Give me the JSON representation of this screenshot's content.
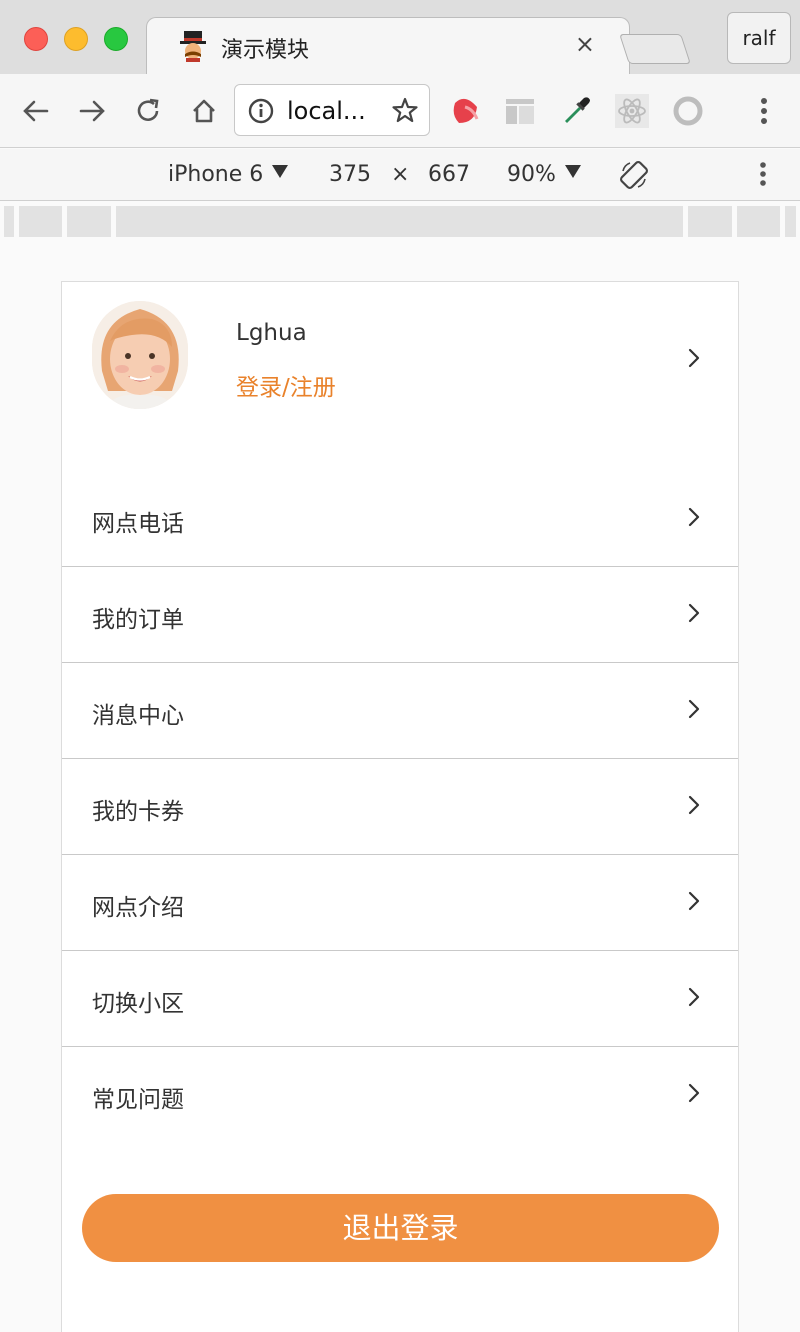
{
  "browser": {
    "tab_title": "演示模块",
    "tab_close": "×",
    "profile_label": "ralf",
    "address": "local...",
    "icons": [
      "back-arrow-icon",
      "forward-arrow-icon",
      "reload-icon",
      "home-icon",
      "info-icon",
      "star-icon",
      "extension-icons"
    ]
  },
  "device_toolbar": {
    "device": "iPhone 6",
    "width": "375",
    "times": "×",
    "height": "667",
    "zoom": "90%"
  },
  "profile": {
    "username": "Lghua",
    "login_link": "登录/注册"
  },
  "menu": [
    {
      "label": "网点电话"
    },
    {
      "label": "我的订单"
    },
    {
      "label": "消息中心"
    },
    {
      "label": "我的卡券"
    },
    {
      "label": "网点介绍"
    },
    {
      "label": "切换小区"
    },
    {
      "label": "常见问题"
    }
  ],
  "logout_label": "退出登录",
  "colors": {
    "accent_orange": "#f09042",
    "link_orange": "#e9822b",
    "text": "#333333"
  }
}
